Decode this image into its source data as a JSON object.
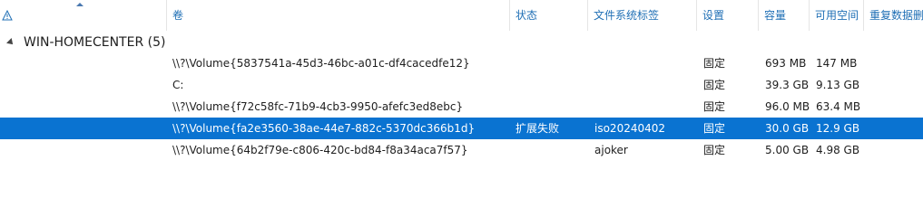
{
  "columns": {
    "warning_icon": "warning-triangle-icon",
    "volume": "卷",
    "status": "状态",
    "fs_label": "文件系统标签",
    "provisioning": "设置",
    "capacity": "容量",
    "free_space": "可用空间",
    "dedup": "重复数据删除率"
  },
  "group": {
    "label": "WIN-HOMECENTER (5)"
  },
  "rows": [
    {
      "volume": "\\\\?\\Volume{5837541a-45d3-46bc-a01c-df4cacedfe12}",
      "status": "",
      "fs_label": "",
      "provisioning": "固定",
      "capacity": "693 MB",
      "free_space": "147 MB",
      "dedup": "",
      "selected": false
    },
    {
      "volume": "C:",
      "status": "",
      "fs_label": "",
      "provisioning": "固定",
      "capacity": "39.3 GB",
      "free_space": "9.13 GB",
      "dedup": "",
      "selected": false
    },
    {
      "volume": "\\\\?\\Volume{f72c58fc-71b9-4cb3-9950-afefc3ed8ebc}",
      "status": "",
      "fs_label": "",
      "provisioning": "固定",
      "capacity": "96.0 MB",
      "free_space": "63.4 MB",
      "dedup": "",
      "selected": false
    },
    {
      "volume": "\\\\?\\Volume{fa2e3560-38ae-44e7-882c-5370dc366b1d}",
      "status": "扩展失败",
      "fs_label": "iso20240402",
      "provisioning": "固定",
      "capacity": "30.0 GB",
      "free_space": "12.9 GB",
      "dedup": "",
      "selected": true
    },
    {
      "volume": "\\\\?\\Volume{64b2f79e-c806-420c-bd84-f8a34aca7f57}",
      "status": "",
      "fs_label": "ajoker",
      "provisioning": "固定",
      "capacity": "5.00 GB",
      "free_space": "4.98 GB",
      "dedup": "",
      "selected": false
    }
  ],
  "colors": {
    "header_text": "#1f6fb5",
    "selection": "#0a73d1"
  }
}
